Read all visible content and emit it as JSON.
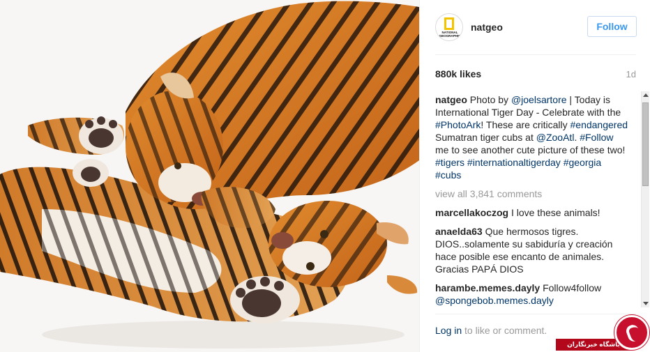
{
  "post": {
    "username": "natgeo",
    "avatar_label": "NATIONAL GEOGRAPHIC",
    "follow_label": "Follow",
    "likes": "880k likes",
    "age": "1d",
    "caption": {
      "user": "natgeo",
      "t1": "Photo by ",
      "l1": "@joelsartore",
      "t2": " | Today is International Tiger Day - Celebrate with the ",
      "l2": "#PhotoArk",
      "t3": "! These are critically ",
      "l3": "#endangered",
      "t4": " Sumatran tiger cubs at ",
      "l4": "@ZooAtl",
      "t5": ". ",
      "l5": "#Follow",
      "t6": " me to see another cute picture of these two! ",
      "l6": "#tigers",
      "t7": " ",
      "l7": "#internationaltigerday",
      "t8": " ",
      "l8": "#georgia",
      "t9": " ",
      "l9": "#cubs"
    },
    "view_all": "view all 3,841 comments",
    "comments": [
      {
        "user": "marcellakoczog",
        "text": " I love these animals!"
      },
      {
        "user": "anaelda63",
        "text": " Que hermosos tigres. DIOS..solamente su sabiduría y creación hace posible ese encanto de animales. Gracias PAPÁ DIOS"
      },
      {
        "user": "harambe.memes.dayly",
        "text": " Follow4follow ",
        "link": "@spongebob.memes.dayly"
      }
    ],
    "login_link": "Log in",
    "login_rest": " to like or comment."
  },
  "watermark": {
    "text": "باشگاه خبرنگاران"
  },
  "colors": {
    "link": "#003569",
    "follow": "#3897f0",
    "muted": "#999999",
    "watermark": "#c6102e"
  },
  "icons": [
    "natgeo-logo-icon",
    "scroll-up-icon",
    "scroll-down-icon",
    "phone-logo-icon"
  ]
}
